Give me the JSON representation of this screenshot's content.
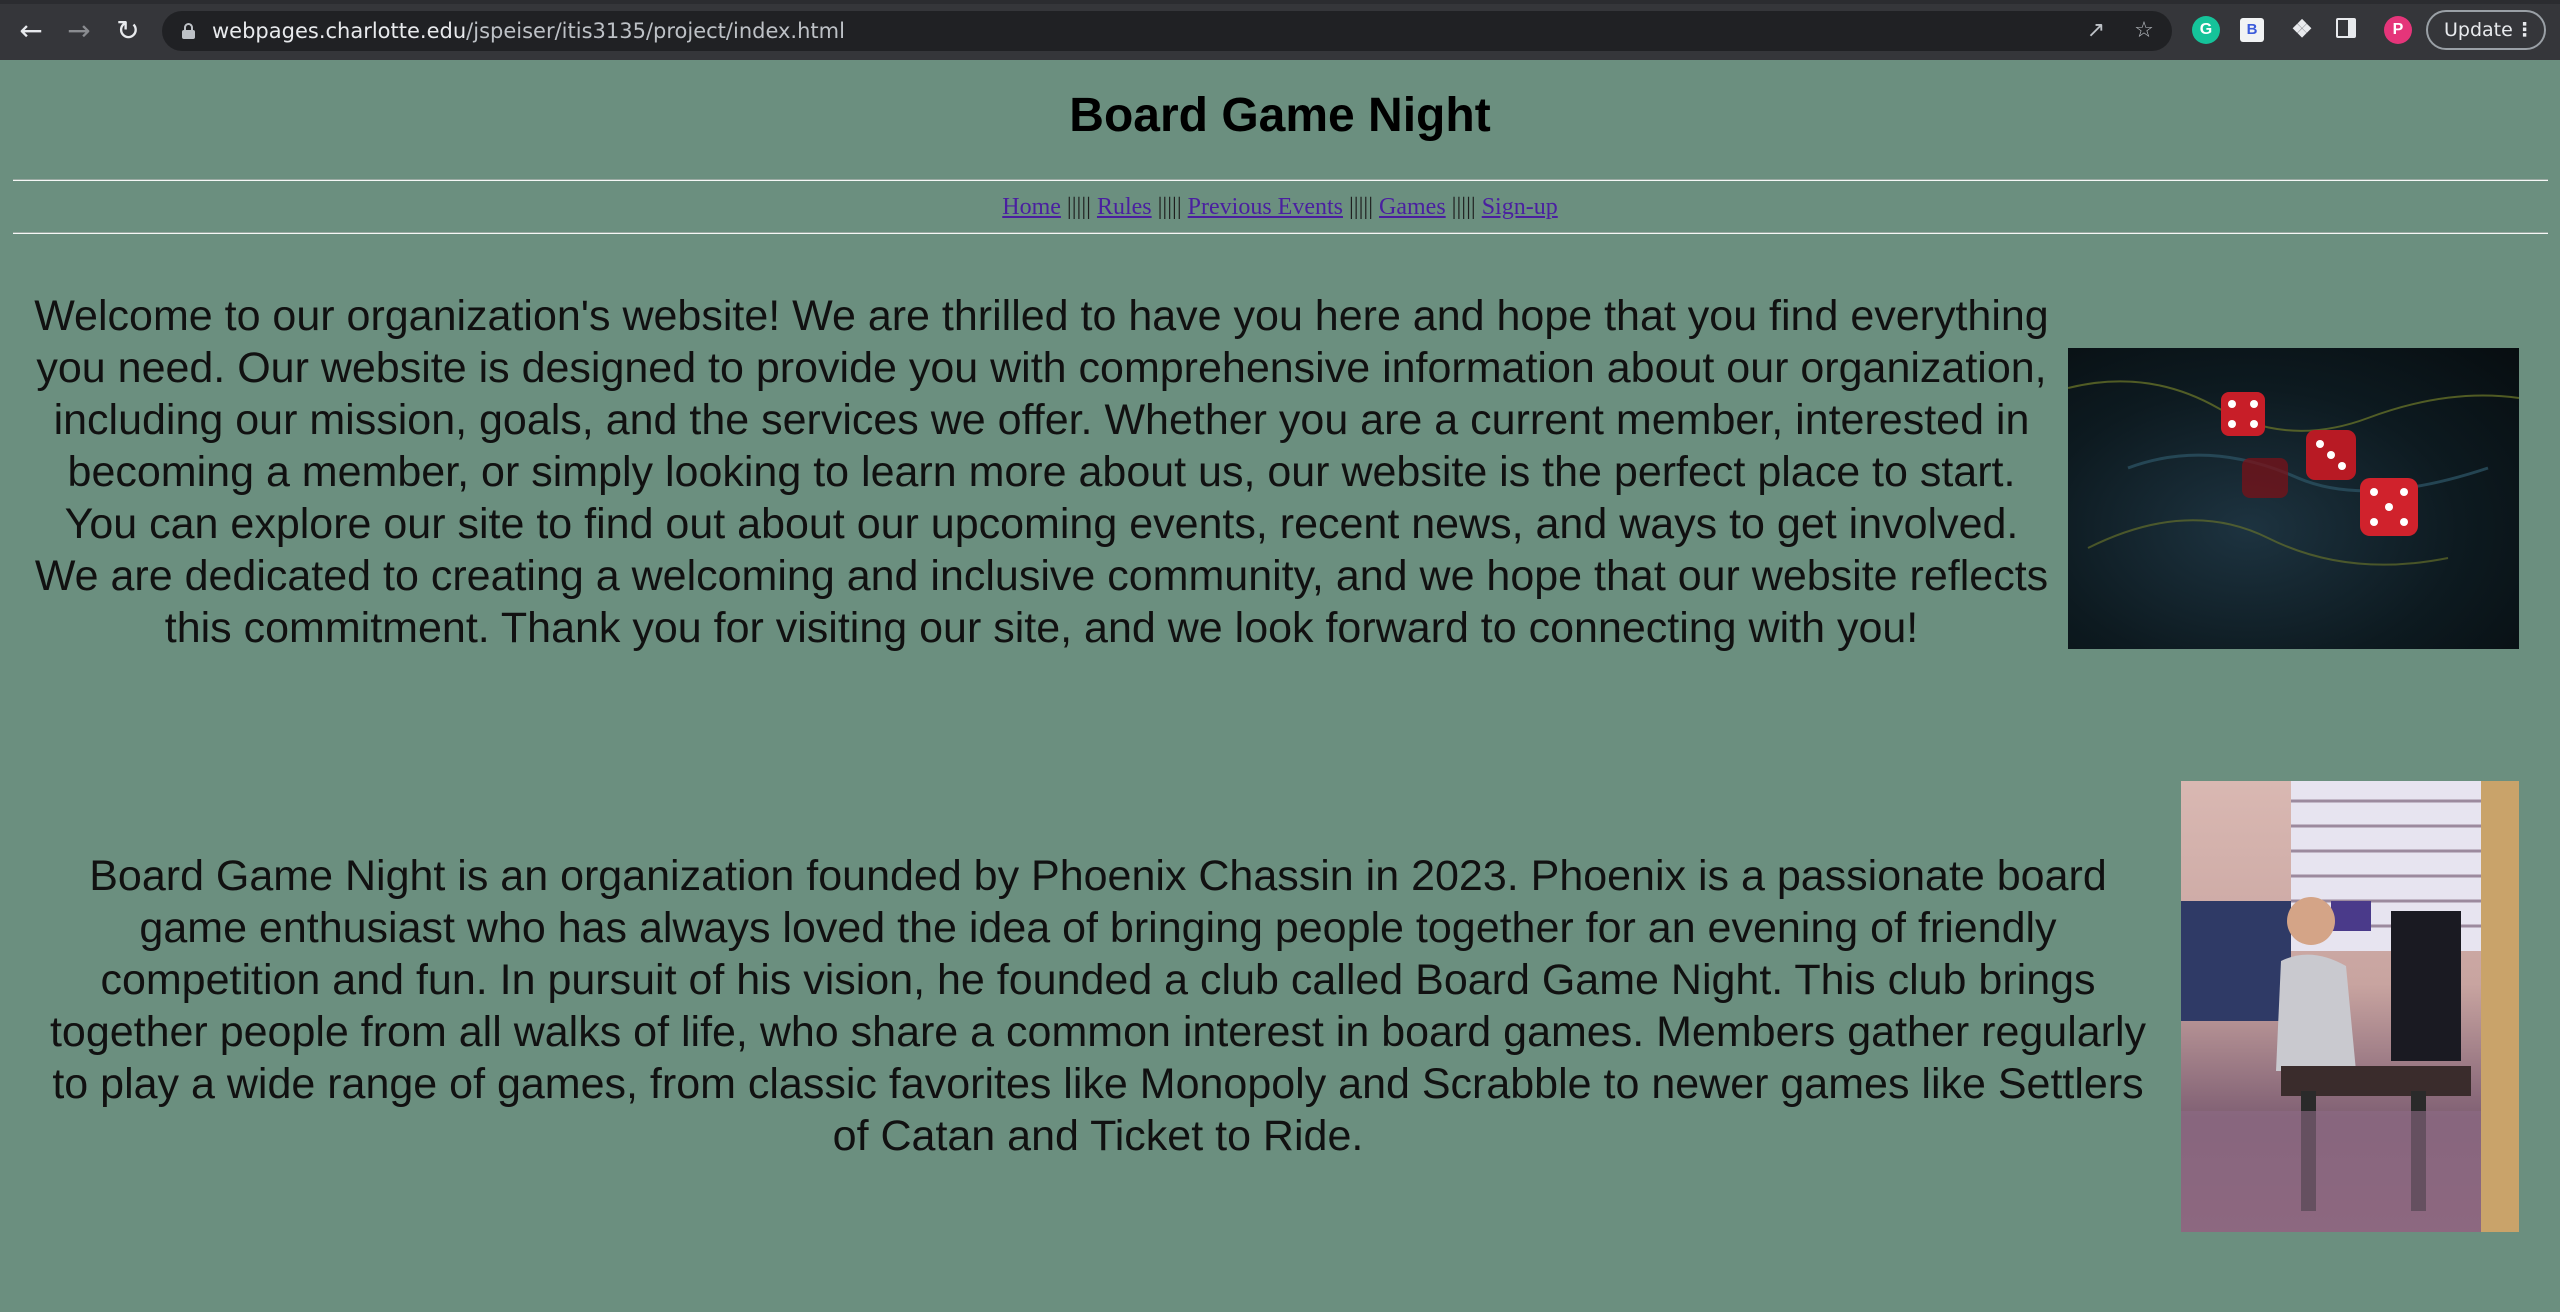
{
  "browser": {
    "url_host": "webpages.charlotte.edu",
    "url_path": "/jspeiser/itis3135/project/index.html",
    "update_label": "Update",
    "profile_initial": "P",
    "grammarly_initial": "G",
    "ext_b_initial": "B"
  },
  "page": {
    "title": "Board Game Night",
    "nav": {
      "links": [
        "Home",
        "Rules",
        "Previous Events",
        "Games",
        "Sign-up"
      ],
      "separator": " ||||| "
    },
    "welcome_text": "Welcome to our organization's website! We are thrilled to have you here and hope that you find everything you need. Our website is designed to provide you with comprehensive information about our organization, including our mission, goals, and the services we offer. Whether you are a current member, interested in becoming a member, or simply looking to learn more about us, our website is the perfect place to start. You can explore our site to find out about our upcoming events, recent news, and ways to get involved. We are dedicated to creating a welcoming and inclusive community, and we hope that our website reflects this commitment. Thank you for visiting our site, and we look forward to connecting with you!",
    "about_text": "Board Game Night is an organization founded by Phoenix Chassin in 2023. Phoenix is a passionate board game enthusiast who has always loved the idea of bringing people together for an evening of friendly competition and fun. In pursuit of his vision, he founded a club called Board Game Night. This club brings together people from all walks of life, who share a common interest in board games. Members gather regularly to play a wide range of games, from classic favorites like Monopoly and Scrabble to newer games like Settlers of Catan and Ticket to Ride."
  },
  "colors": {
    "page_background": "#6b8f7f",
    "link": "#4a1fa0",
    "chrome": "#35363a"
  }
}
